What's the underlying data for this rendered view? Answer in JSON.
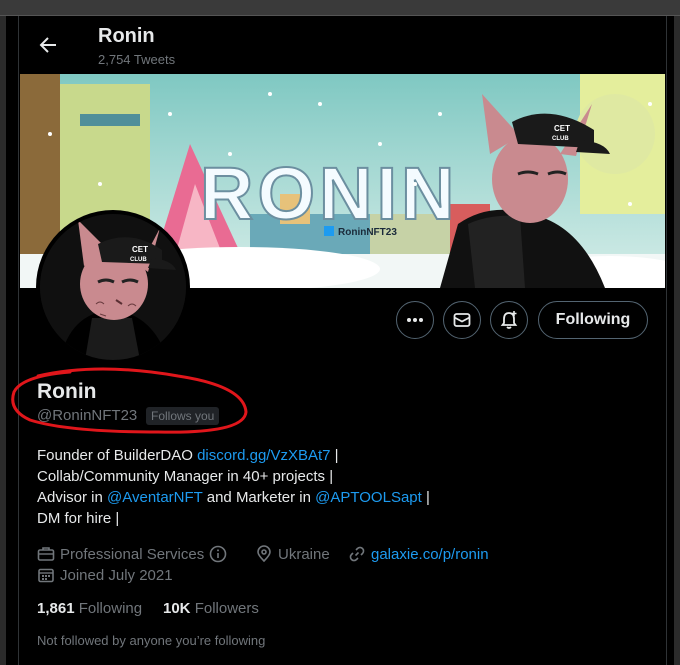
{
  "header": {
    "name": "Ronin",
    "tweet_count": "2,754 Tweets"
  },
  "banner": {
    "title": "RONIN",
    "tag": "RoninNFT23",
    "cap_text_1": "CET",
    "cap_text_2": "CLUB"
  },
  "avatar": {
    "cap_text_1": "CET",
    "cap_text_2": "CLUB"
  },
  "actions": {
    "more": "more-icon",
    "message": "mail-icon",
    "notify": "bell-plus-icon",
    "following_label": "Following"
  },
  "profile": {
    "name": "Ronin",
    "handle": "@RoninNFT23",
    "follows_you": "Follows you"
  },
  "bio": {
    "line1_text": "Founder of BuilderDAO ",
    "line1_link": "discord.gg/VzXBAt7",
    "line1_tail": " |",
    "line2": "Collab/Community Manager in 40+ projects |",
    "line3_a": "Advisor in ",
    "line3_link1": "@AventarNFT",
    "line3_b": " and Marketer in ",
    "line3_link2": "@APTOOLSapt",
    "line3_tail": " |",
    "line4": "DM for hire |"
  },
  "meta": {
    "category": "Professional Services",
    "location": "Ukraine",
    "website": "galaxie.co/p/ronin",
    "joined": "Joined July 2021"
  },
  "stats": {
    "following_count": "1,861",
    "following_label": "Following",
    "followers_count": "10K",
    "followers_label": "Followers"
  },
  "footer": {
    "not_followed": "Not followed by anyone you’re following"
  },
  "colors": {
    "accent": "#1d9bf0",
    "annotation": "#e0161b",
    "background": "#000000"
  }
}
